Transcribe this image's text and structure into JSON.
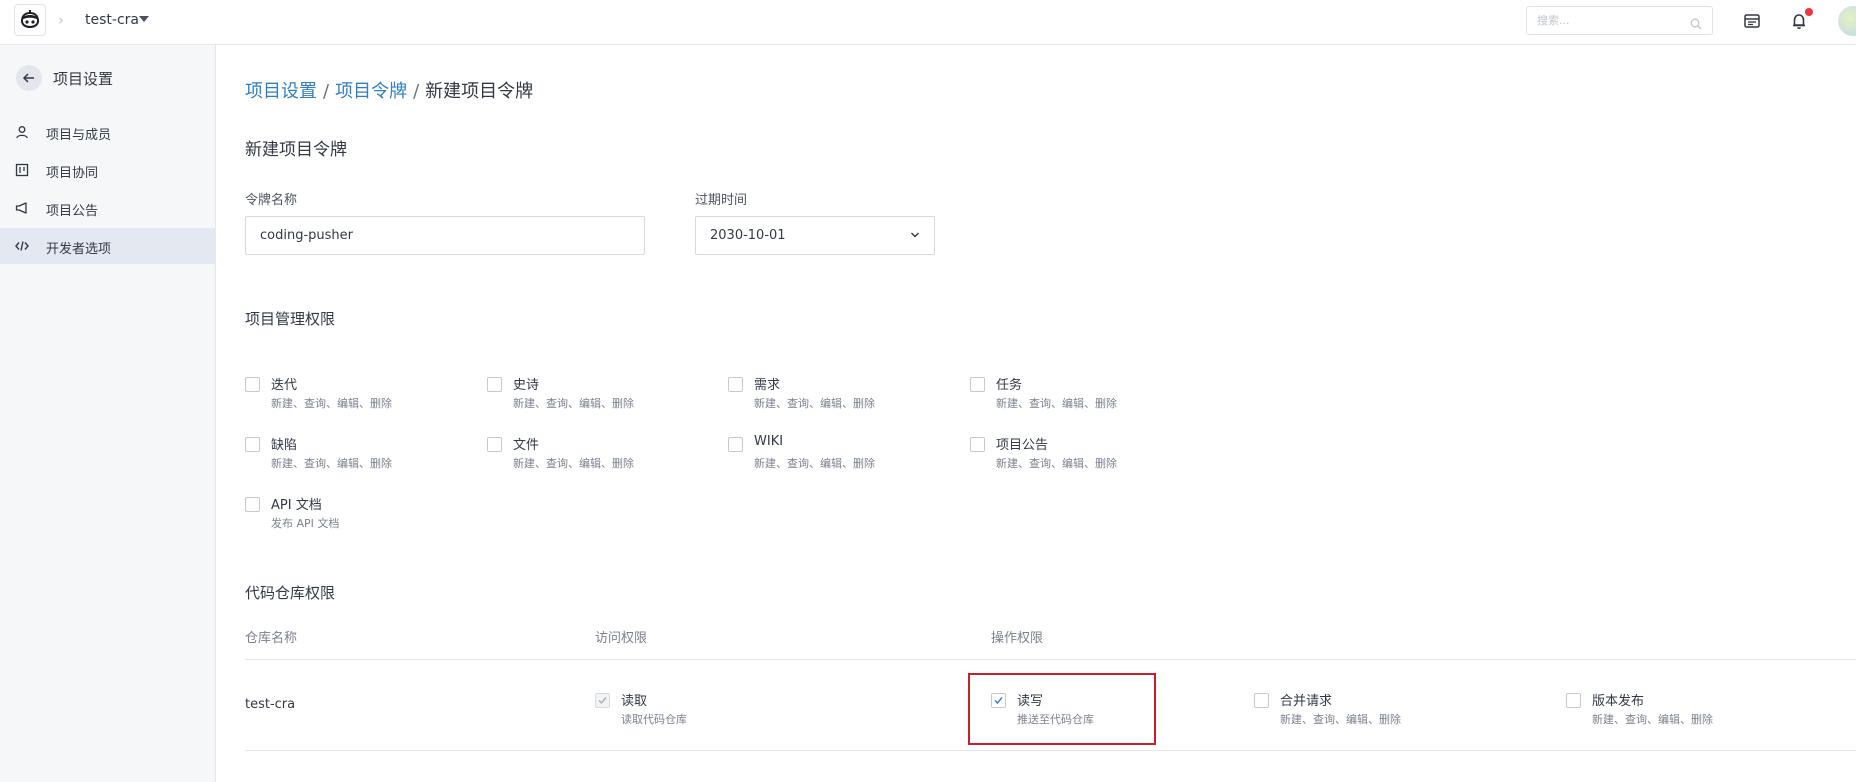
{
  "topbar": {
    "project_name": "test-cra",
    "search_placeholder": "搜索...",
    "icons": [
      "logo-icon",
      "chevron-right-icon",
      "caret-down-icon",
      "search-icon",
      "calendar-table-icon",
      "bell-icon",
      "avatar"
    ]
  },
  "sidebar": {
    "back_title": "项目设置",
    "items": [
      {
        "label": "项目与成员",
        "icon": "user-icon",
        "active": false
      },
      {
        "label": "项目协同",
        "icon": "board-icon",
        "active": false
      },
      {
        "label": "项目公告",
        "icon": "megaphone-icon",
        "active": false
      },
      {
        "label": "开发者选项",
        "icon": "code-icon",
        "active": true
      }
    ]
  },
  "breadcrumb": {
    "level1": "项目设置",
    "level2": "项目令牌",
    "current": "新建项目令牌",
    "separator": "/"
  },
  "form": {
    "title": "新建项目令牌",
    "token_name_label": "令牌名称",
    "token_name_value": "coding-pusher",
    "expire_label": "过期时间",
    "expire_value": "2030-10-01"
  },
  "project_permissions": {
    "title": "项目管理权限",
    "items": [
      {
        "name": "迭代",
        "desc": "新建、查询、编辑、删除",
        "checked": false
      },
      {
        "name": "史诗",
        "desc": "新建、查询、编辑、删除",
        "checked": false
      },
      {
        "name": "需求",
        "desc": "新建、查询、编辑、删除",
        "checked": false
      },
      {
        "name": "任务",
        "desc": "新建、查询、编辑、删除",
        "checked": false
      },
      {
        "name": "缺陷",
        "desc": "新建、查询、编辑、删除",
        "checked": false
      },
      {
        "name": "文件",
        "desc": "新建、查询、编辑、删除",
        "checked": false
      },
      {
        "name": "WIKI",
        "desc": "新建、查询、编辑、删除",
        "checked": false
      },
      {
        "name": "项目公告",
        "desc": "新建、查询、编辑、删除",
        "checked": false
      },
      {
        "name": "API 文档",
        "desc": "发布 API 文档",
        "checked": false
      }
    ]
  },
  "repo_permissions": {
    "title": "代码仓库权限",
    "columns": {
      "repo": "仓库名称",
      "access": "访问权限",
      "operation": "操作权限"
    },
    "rows": [
      {
        "repo": "test-cra",
        "access": {
          "name": "读取",
          "desc": "读取代码仓库",
          "checked": true,
          "disabled": true
        },
        "operations": [
          {
            "name": "读写",
            "desc": "推送至代码仓库",
            "checked": true,
            "highlighted": true
          },
          {
            "name": "合并请求",
            "desc": "新建、查询、编辑、删除",
            "checked": false
          },
          {
            "name": "版本发布",
            "desc": "新建、查询、编辑、删除",
            "checked": false
          }
        ]
      }
    ]
  },
  "colors": {
    "link": "#2f7fc6",
    "highlight_border": "#c8202a",
    "notification_dot": "#f0353d",
    "sidebar_bg": "#f6f7f9",
    "sidebar_active": "#e4e8f0"
  }
}
